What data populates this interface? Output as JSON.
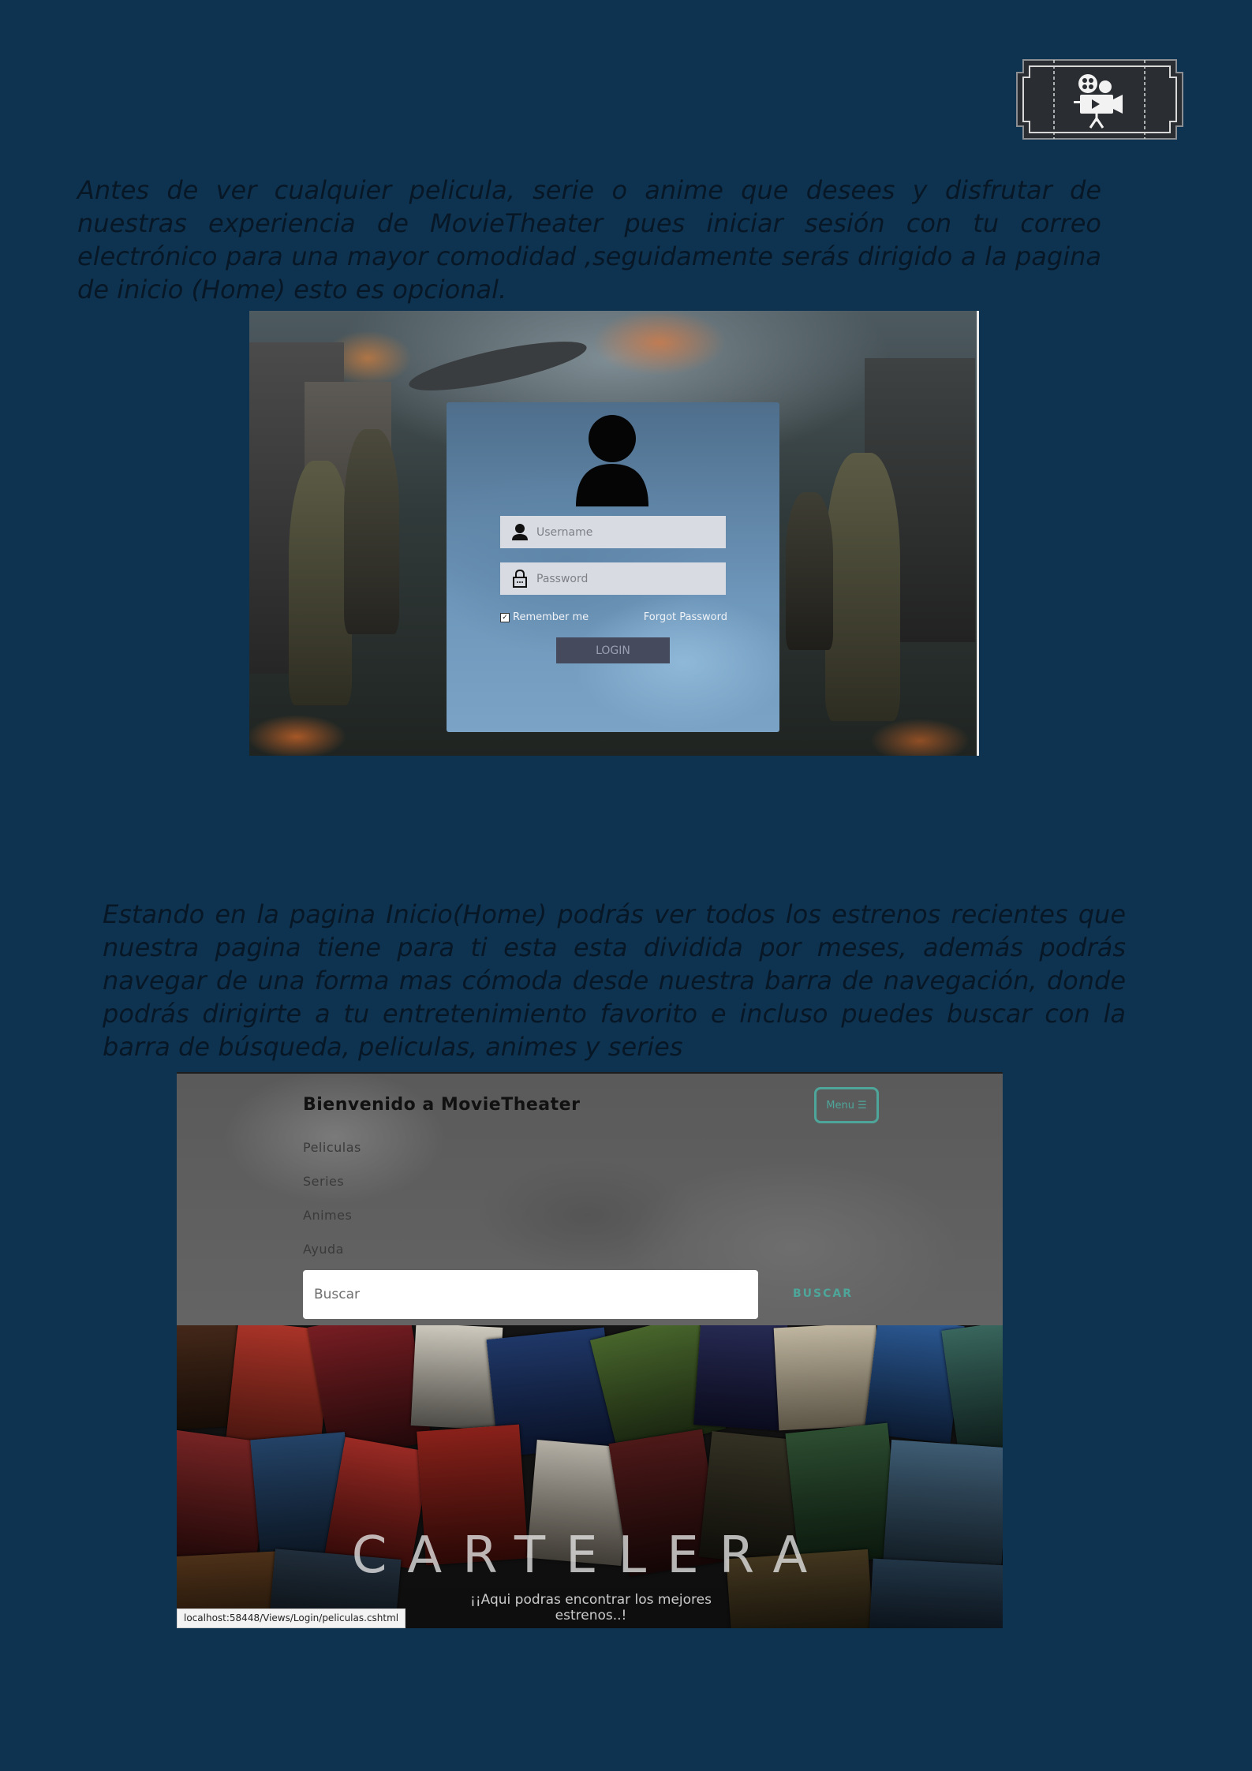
{
  "paragraphs": {
    "intro_login": "Antes de ver cualquier pelicula, serie o anime que desees y disfrutar de nuestras experiencia de MovieTheater pues iniciar sesión con tu correo electrónico  para una mayor comodidad ,seguidamente serás dirigido a la pagina de inicio (Home) esto es opcional.",
    "intro_home": "Estando en la pagina Inicio(Home) podrás ver todos los estrenos recientes que nuestra pagina tiene para ti esta esta dividida por meses, además podrás navegar de una forma mas cómoda desde nuestra barra de navegación, donde podrás dirigirte a tu entretenimiento favorito e incluso puedes buscar con la barra de búsqueda, peliculas, animes y series"
  },
  "logo": {
    "icon": "movie-camera-ticket-icon"
  },
  "login": {
    "username_placeholder": "Username",
    "password_placeholder": "Password",
    "remember_label": "Remember me",
    "forgot_label": "Forgot Password",
    "login_button": "LOGIN"
  },
  "home": {
    "brand": "Bienvenido a MovieTheater",
    "menu_label": "Menu ☰",
    "nav": [
      "Peliculas",
      "Series",
      "Animes",
      "Ayuda"
    ],
    "search_placeholder": "Buscar",
    "search_button": "BUSCAR",
    "hero_title": "CARTELERA",
    "hero_subtitle": "¡¡Aqui podras encontrar los mejores estrenos..!",
    "status_url": "localhost:58448/Views/Login/peliculas.cshtml"
  }
}
